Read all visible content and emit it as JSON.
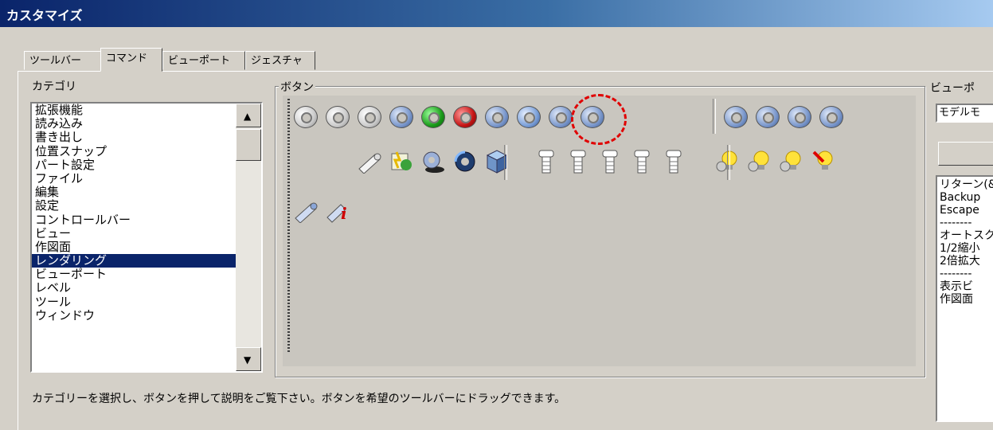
{
  "window": {
    "title": "カスタマイズ"
  },
  "tabs": [
    {
      "label": "ツールバー"
    },
    {
      "label": "コマンド"
    },
    {
      "label": "ビューポート"
    },
    {
      "label": "ジェスチャ"
    }
  ],
  "category": {
    "label": "カテゴリ",
    "items": [
      "拡張機能",
      "読み込み",
      "書き出し",
      "位置スナップ",
      "パート設定",
      "ファイル",
      "編集",
      "設定",
      "コントロールバー",
      "ビュー",
      "作図面",
      "レンダリング",
      "ビューポート",
      "レベル",
      "ツール",
      "ウィンドウ"
    ],
    "selected_index": 11
  },
  "buttons_group": {
    "label": "ボタン"
  },
  "icons_row1": [
    "render-ring-icon",
    "render-ring-icon",
    "render-ring-icon",
    "render-ring-blue-icon",
    "render-ring-green-icon",
    "render-ring-red-icon",
    "render-ring-blue-icon",
    "render-ring-selected-icon",
    "render-ring-blue-icon",
    "render-ring-blue-icon",
    "render-ring-blue-icon",
    "render-ring-blue-icon",
    "render-ring-blue-icon",
    "render-ring-blue-icon"
  ],
  "icons_row2": [
    "cylinder-icon",
    "texture-icon",
    "ring-shadow-icon",
    "ring-dark-icon",
    "cube-icon",
    "bolt-icon",
    "bolt-icon",
    "bolt-icon",
    "bolt-icon",
    "bolt-icon",
    "light-bulb-icon",
    "light-bulb-icon",
    "light-bulb-icon",
    "light-bulb-off-icon"
  ],
  "icons_row3": [
    "cylinder-blue-icon",
    "info-icon"
  ],
  "viewport": {
    "label": "ビューポ",
    "combo_value": "モデルモ",
    "description_lines": [
      "リターン(&",
      "Backup",
      "Escape",
      "--------",
      "オートスク",
      "1/2縮小",
      "2倍拡大",
      "--------",
      "表示ビ",
      "作図面"
    ]
  },
  "hint": "カテゴリーを選択し、ボタンを押して説明をご覧下さい。ボタンを希望のツールバーにドラッグできます。"
}
